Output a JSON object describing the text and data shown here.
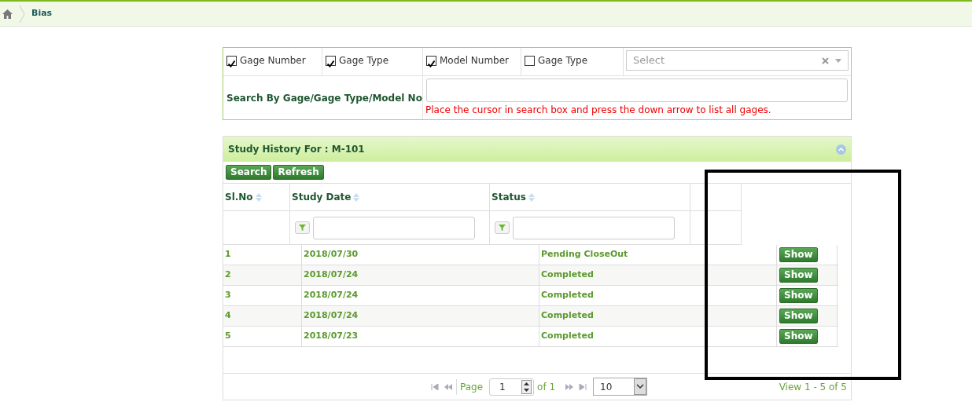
{
  "breadcrumb": {
    "current": "Bias"
  },
  "filters": {
    "options": [
      {
        "label": "Gage Number",
        "checked": true
      },
      {
        "label": "Gage Type",
        "checked": true
      },
      {
        "label": "Model Number",
        "checked": true
      },
      {
        "label": "Gage Type",
        "checked": false
      }
    ],
    "select": {
      "placeholder": "Select"
    },
    "search_label": "Search By Gage/Gage Type/Model No",
    "hint": "Place the cursor in search box and press the down arrow to list all gages."
  },
  "grid": {
    "title": "Study History For : M-101",
    "buttons": [
      "Search",
      "Refresh"
    ],
    "columns": [
      {
        "label": "Sl.No",
        "filter": false
      },
      {
        "label": "Study Date",
        "filter": true
      },
      {
        "label": "Status",
        "filter": true
      }
    ],
    "rows": [
      {
        "sl": "1",
        "date": "2018/07/30",
        "status": "Pending CloseOut",
        "action": "Show"
      },
      {
        "sl": "2",
        "date": "2018/07/24",
        "status": "Completed",
        "action": "Show"
      },
      {
        "sl": "3",
        "date": "2018/07/24",
        "status": "Completed",
        "action": "Show"
      },
      {
        "sl": "4",
        "date": "2018/07/24",
        "status": "Completed",
        "action": "Show"
      },
      {
        "sl": "5",
        "date": "2018/07/23",
        "status": "Completed",
        "action": "Show"
      }
    ],
    "pager": {
      "page_label": "Page",
      "page": "1",
      "of": "of 1",
      "page_size": "10",
      "summary": "View 1 - 5 of 5"
    }
  },
  "annotation": {
    "kind": "rectangle"
  }
}
